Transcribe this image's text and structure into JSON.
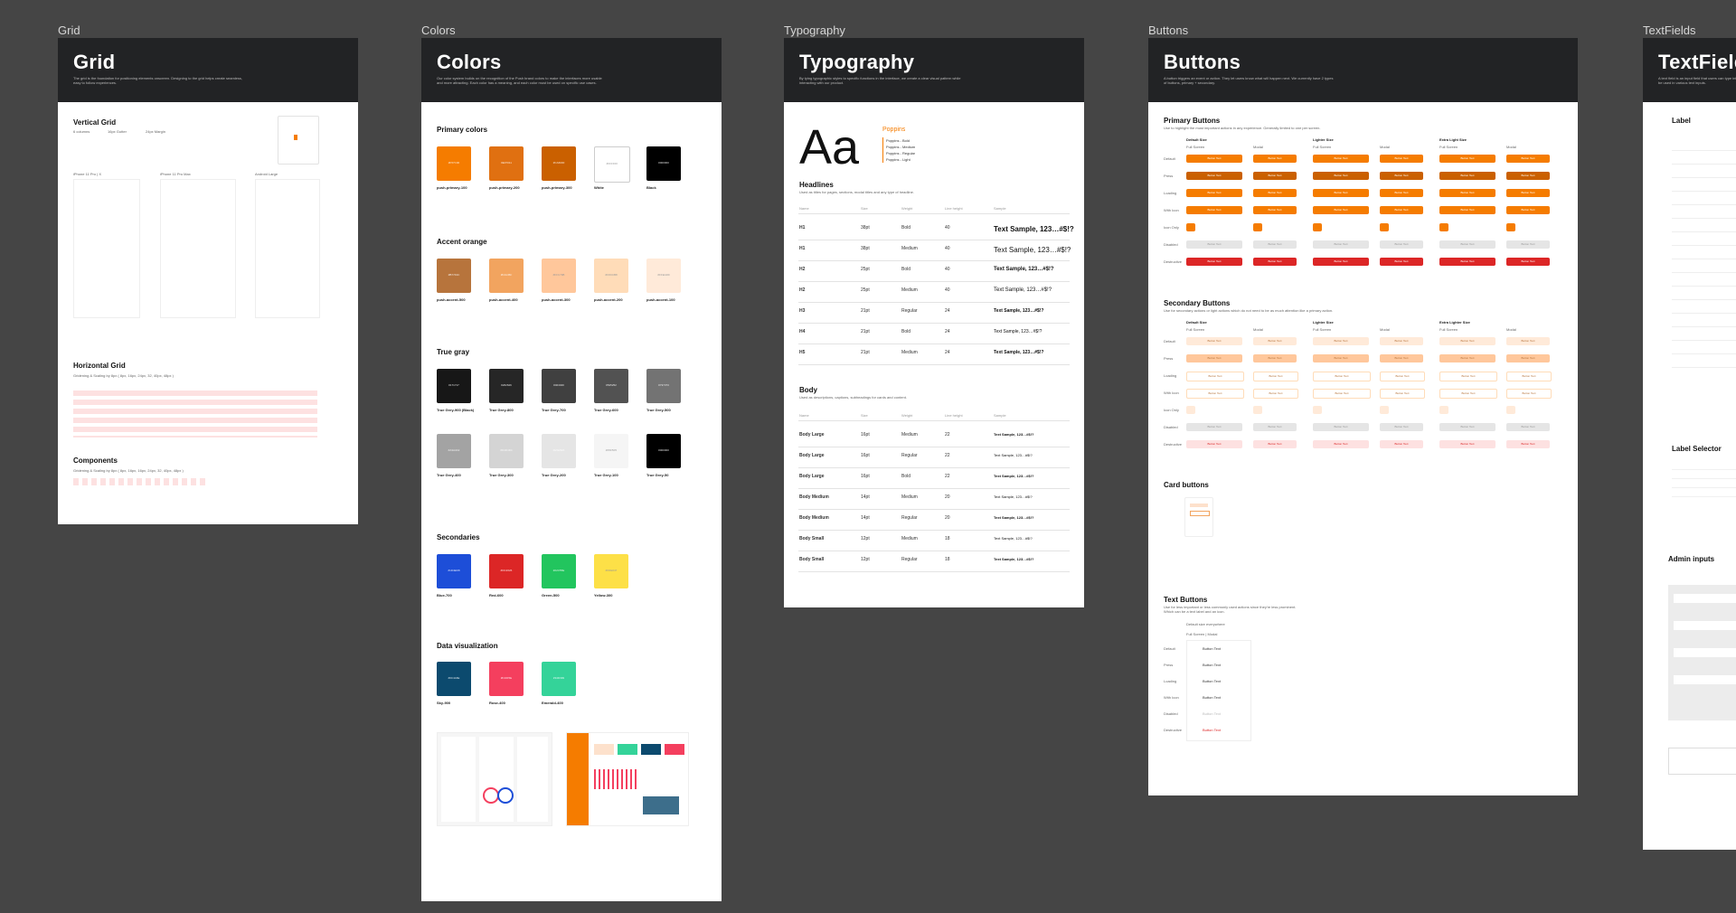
{
  "frames": {
    "grid": {
      "label": "Grid",
      "title": "Grid",
      "desc": "The grid is the foundation for positioning elements onscreen. Designing to the grid helps create seamless, easy to follow experiences."
    },
    "colors": {
      "label": "Colors",
      "title": "Colors",
      "desc": "Our color system builds on the recognition of the Push brand colors to make the interfaces more usable and more attracting. Each color has a meaning, and each color must be used on specific use cases."
    },
    "typography": {
      "label": "Typography",
      "title": "Typography",
      "desc": "By tying typographic styles to specific functions in the interface, we create a clear visual pattern while interacting with our product."
    },
    "buttons": {
      "label": "Buttons",
      "title": "Buttons",
      "desc": "A button triggers an event or action. They let users know what will happen next. We currently have 2 types of buttons, primary + secondary."
    },
    "textfields": {
      "label": "TextFields",
      "title": "TextFields",
      "desc": "A text field is an input field that users can type into. Text fields with additional options and keyboard types to be used in various text inputs."
    }
  },
  "grid": {
    "vertical": "Vertical Grid",
    "cols": "6 columns",
    "gutter": "16px Gutter",
    "margin": "24px Margin",
    "devices": [
      "iPhone 11 Pro | X",
      "iPhone 11 Pro Max",
      "Android Large"
    ],
    "horizontal": "Horizontal Grid",
    "horizontal_desc": "Gridening & Scaling by 8px ( 8px, 16px, 24px, 32, 40px, 48px )",
    "components": "Components",
    "components_desc": "Gridening & Scaling by 8px ( 8px, 16px, 16px, 24px, 32, 40px, 48px )"
  },
  "colors": {
    "primary": "Primary colors",
    "primary_sw": [
      {
        "hex": "#F57C00",
        "c": "#f57c00",
        "name": "push-primary-100"
      },
      {
        "hex": "#E07011",
        "c": "#e07011",
        "name": "push-primary-200"
      },
      {
        "hex": "#CA6000",
        "c": "#ca6000",
        "name": "push-primary-300"
      },
      {
        "hex": "#FFFFFF",
        "c": "#ffffff",
        "name": "White"
      },
      {
        "hex": "#000000",
        "c": "#000000",
        "name": "Black"
      }
    ],
    "accent": "Accent orange",
    "accent_sw": [
      {
        "hex": "#B7743C",
        "c": "#b7743c",
        "name": "push-accent-500"
      },
      {
        "hex": "#F2A45F",
        "c": "#f2a45f",
        "name": "push-accent-400"
      },
      {
        "hex": "#FFC79B",
        "c": "#ffc79b",
        "name": "push-accent-300"
      },
      {
        "hex": "#FFDCB8",
        "c": "#ffdcb8",
        "name": "push-accent-200"
      },
      {
        "hex": "#FFEAD9",
        "c": "#ffead9",
        "name": "push-accent-100"
      }
    ],
    "gray": "True gray",
    "gray_sw1": [
      {
        "hex": "#171717",
        "c": "#171717",
        "name": "True Grey-900 (Black)"
      },
      {
        "hex": "#262626",
        "c": "#262626",
        "name": "True Grey-800"
      },
      {
        "hex": "#404040",
        "c": "#404040",
        "name": "True Grey-700"
      },
      {
        "hex": "#525252",
        "c": "#525252",
        "name": "True Grey-600"
      },
      {
        "hex": "#737373",
        "c": "#737373",
        "name": "True Grey-500"
      }
    ],
    "gray_sw2": [
      {
        "hex": "#A3A3A3",
        "c": "#a3a3a3",
        "name": "True Grey-400"
      },
      {
        "hex": "#D4D4D4",
        "c": "#d4d4d4",
        "name": "True Grey-300"
      },
      {
        "hex": "#E5E5E5",
        "c": "#e5e5e5",
        "name": "True Grey-200"
      },
      {
        "hex": "#F5F5F5",
        "c": "#f5f5f5",
        "name": "True Grey-100"
      },
      {
        "hex": "#000000",
        "c": "#000000",
        "name": "True Grey-50"
      }
    ],
    "secondaries": "Secondaries",
    "sec_sw": [
      {
        "hex": "#1D4ED8",
        "c": "#1d4ed8",
        "name": "Blue-700"
      },
      {
        "hex": "#DC2626",
        "c": "#dc2626",
        "name": "Red-600"
      },
      {
        "hex": "#22C55E",
        "c": "#22c55e",
        "name": "Green-500"
      },
      {
        "hex": "#FDE047",
        "c": "#fde047",
        "name": "Yellow-300"
      }
    ],
    "dataviz": "Data visualization",
    "dv_sw": [
      {
        "hex": "#0C4A6E",
        "c": "#0c4a6e",
        "name": "Sky-900"
      },
      {
        "hex": "#F43F5E",
        "c": "#f43f5e",
        "name": "Rose-400"
      },
      {
        "hex": "#34D399",
        "c": "#34d399",
        "name": "Emerald-400"
      }
    ]
  },
  "typography": {
    "aa": "Aa",
    "font": "Poppins",
    "weights": [
      "Poppins - Bold",
      "Poppins - Medium",
      "Poppins - Regular",
      "Poppins - Light"
    ],
    "headlines": "Headlines",
    "headlines_desc": "Used as titles for pages, sections, modal titles and any type of headline.",
    "cols": [
      "Name",
      "Size",
      "Weight",
      "Line height",
      "Sample"
    ],
    "h_rows": [
      [
        "H1",
        "38pt",
        "Bold",
        "40",
        "Text Sample, 123…#$!?"
      ],
      [
        "H1",
        "38pt",
        "Medium",
        "40",
        "Text Sample, 123…#$!?"
      ],
      [
        "H2",
        "25pt",
        "Bold",
        "40",
        "Text Sample, 123…#$!?"
      ],
      [
        "H2",
        "25pt",
        "Medium",
        "40",
        "Text Sample, 123…#$!?"
      ],
      [
        "H3",
        "21pt",
        "Regular",
        "24",
        "Text Sample, 123…#$!?"
      ],
      [
        "H4",
        "21pt",
        "Bold",
        "24",
        "Text Sample, 123…#$!?"
      ],
      [
        "H5",
        "21pt",
        "Medium",
        "24",
        "Text Sample, 123…#$!?"
      ]
    ],
    "body": "Body",
    "body_desc": "Used as descriptions, captions, subheadings for cards and content.",
    "b_rows": [
      [
        "Body Large",
        "16pt",
        "Medium",
        "22",
        "Text Sample, 123…#$!?"
      ],
      [
        "Body Large",
        "16pt",
        "Regular",
        "22",
        "Text Sample, 123…#$!?"
      ],
      [
        "Body Large",
        "16pt",
        "Bold",
        "22",
        "Text Sample, 123…#$!?"
      ],
      [
        "Body Medium",
        "14pt",
        "Medium",
        "20",
        "Text Sample, 123…#$!?"
      ],
      [
        "Body Medium",
        "14pt",
        "Regular",
        "20",
        "Text Sample, 123…#$!?"
      ],
      [
        "Body Small",
        "12pt",
        "Medium",
        "18",
        "Text Sample, 123…#$!?"
      ],
      [
        "Body Small",
        "12pt",
        "Regular",
        "18",
        "Text Sample, 123…#$!?"
      ]
    ]
  },
  "buttons": {
    "primary": "Primary Buttons",
    "primary_desc": "Use to highlight the most important actions in any experience. Generally limited to one per screen.",
    "sizes": [
      "Default Size",
      "Lighter Size",
      "Extra Light Size"
    ],
    "sizes2": [
      "Default Size",
      "Lighter Size",
      "Extra Lighter Size"
    ],
    "screens": [
      "Full Screen",
      "Modal"
    ],
    "states": [
      "Default",
      "Press",
      "Loading",
      "With Icon",
      "Icon Only",
      "Disabled",
      "Destructive"
    ],
    "label": "Button Text",
    "secondary": "Secondary Buttons",
    "secondary_desc": "Use for secondary actions or light actions which do not need to be as much attention like a primary action.",
    "card": "Card buttons",
    "text": "Text Buttons",
    "text_desc": "Use for less important or less commonly used actions since they're less prominent. Which can be a text label and an icon.",
    "text_default": "Default size everywhere",
    "text_sub": "Full Screen | Modal"
  },
  "textfields": {
    "label": "Label",
    "label_selector": "Label Selector",
    "admin": "Admin inputs"
  }
}
